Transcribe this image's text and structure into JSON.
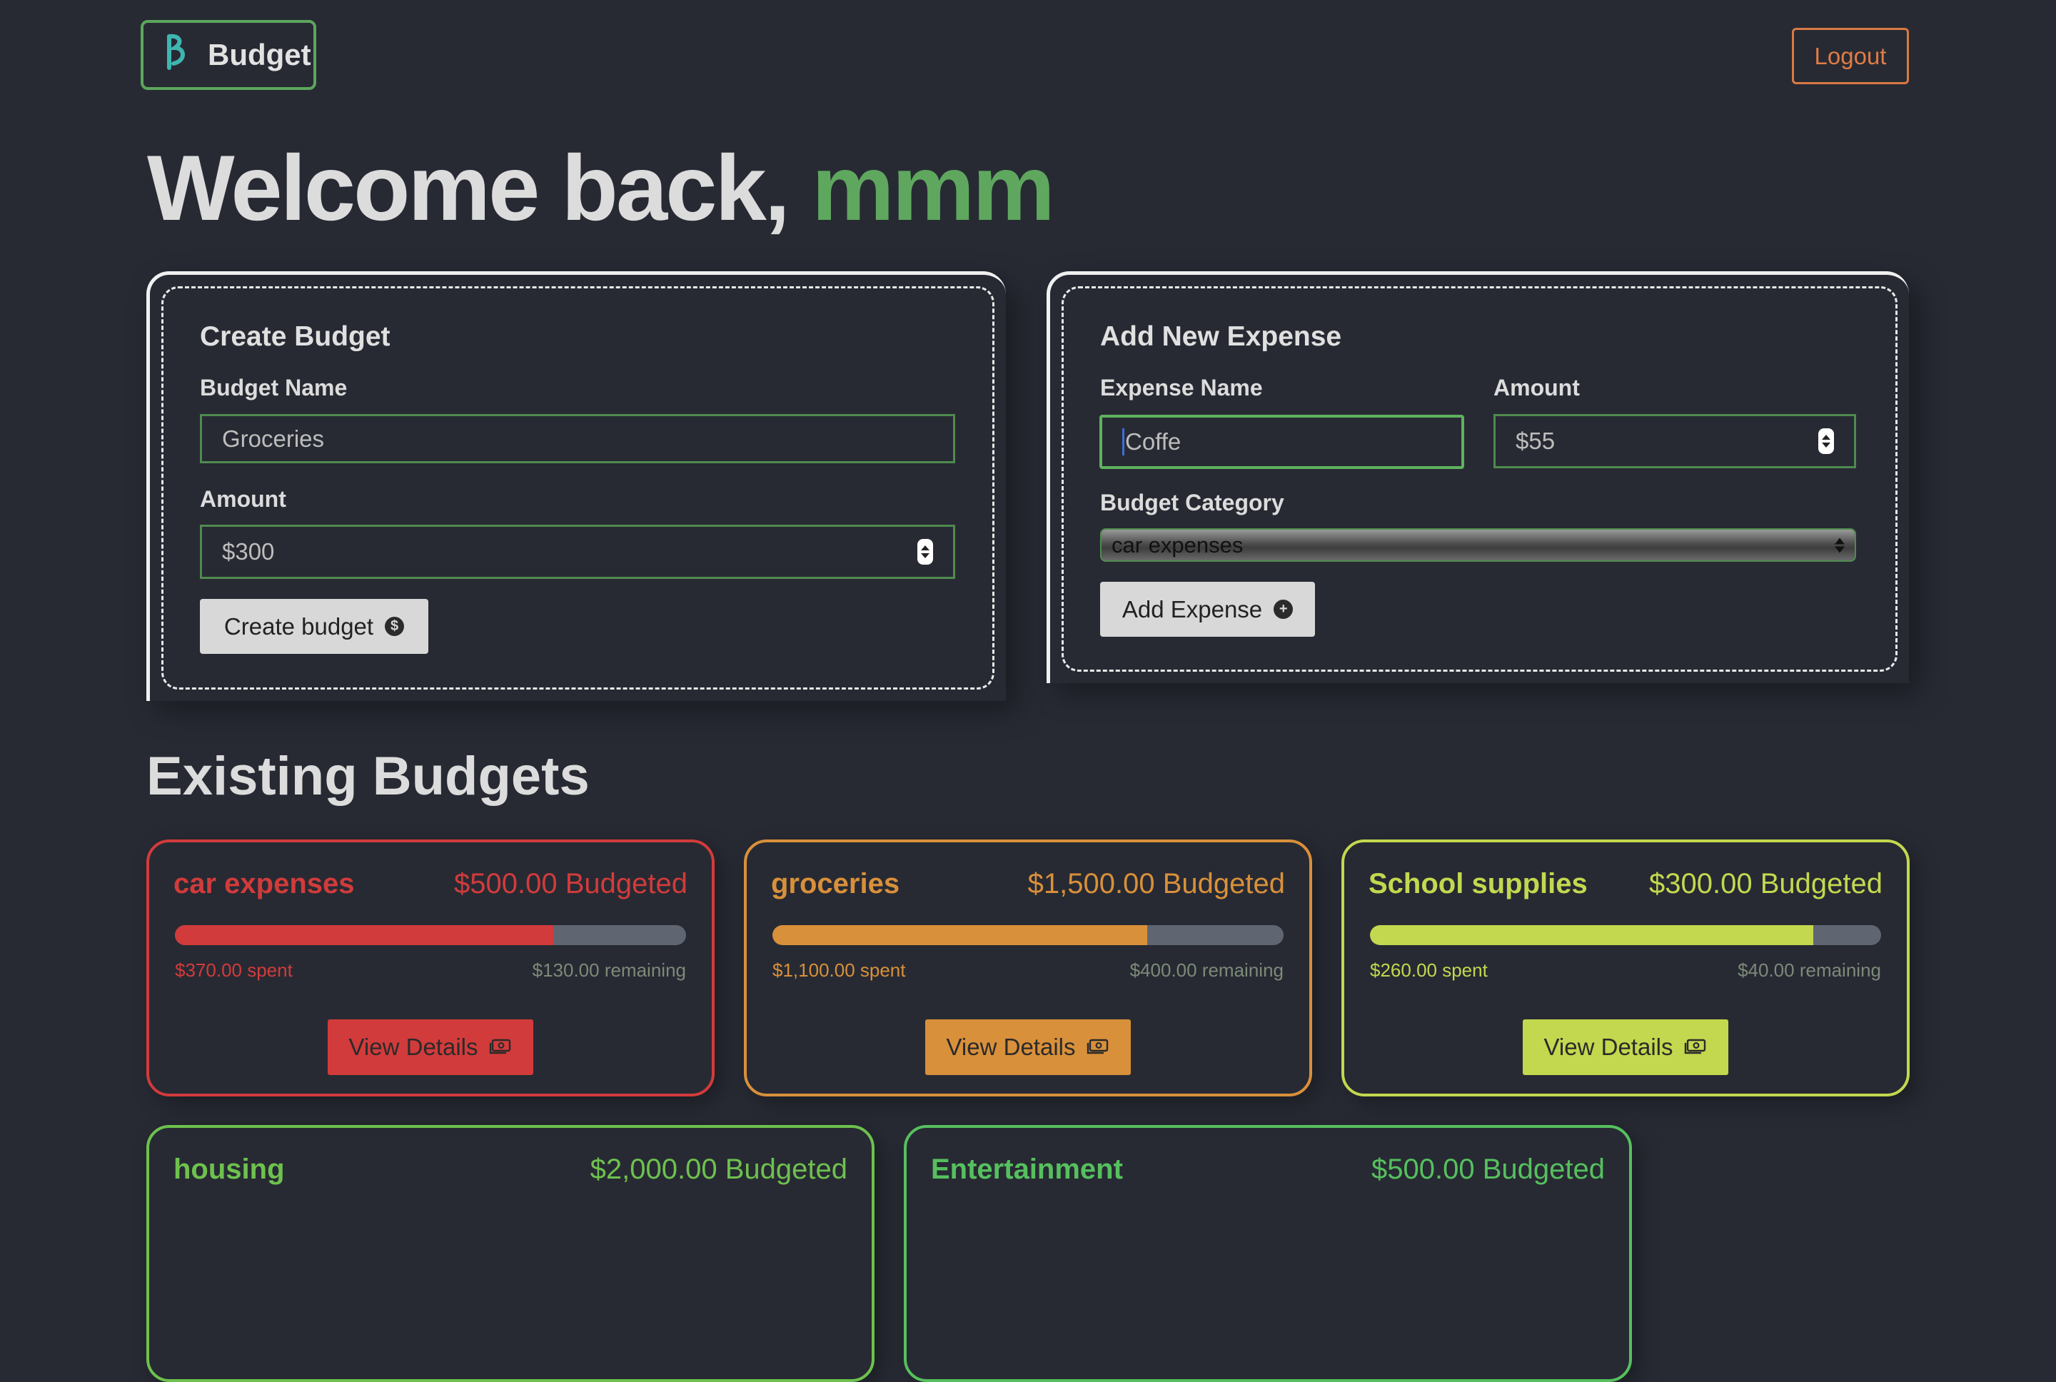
{
  "header": {
    "logo_text": "Budget",
    "logo_icon": "budget-logo-icon",
    "logout_label": "Logout"
  },
  "welcome": {
    "prefix": "Welcome back,",
    "username": "mmm"
  },
  "create_budget": {
    "title": "Create Budget",
    "name_label": "Budget Name",
    "name_placeholder": "Groceries",
    "amount_label": "Amount",
    "amount_placeholder": "$300",
    "submit_label": "Create budget",
    "submit_icon": "dollar-circle-icon"
  },
  "add_expense": {
    "title": "Add New Expense",
    "name_label": "Expense Name",
    "name_value": "Coffe",
    "amount_label": "Amount",
    "amount_placeholder": "$55",
    "category_label": "Budget Category",
    "category_selected": "car expenses",
    "submit_label": "Add Expense",
    "submit_icon": "plus-circle-icon"
  },
  "existing": {
    "title": "Existing Budgets",
    "view_label": "View Details",
    "budgets": [
      {
        "name": "car expenses",
        "budgeted": "$500.00 Budgeted",
        "spent": "$370.00 spent",
        "remaining": "$130.00 remaining",
        "progress": 0.74,
        "color": "#d23b3b"
      },
      {
        "name": "groceries",
        "budgeted": "$1,500.00 Budgeted",
        "spent": "$1,100.00 spent",
        "remaining": "$400.00 remaining",
        "progress": 0.733,
        "color": "#d9903a"
      },
      {
        "name": "School supplies",
        "budgeted": "$300.00 Budgeted",
        "spent": "$260.00 spent",
        "remaining": "$40.00 remaining",
        "progress": 0.867,
        "color": "#c3d84e"
      },
      {
        "name": "housing",
        "budgeted": "$2,000.00 Budgeted",
        "color": "#6ec14e"
      },
      {
        "name": "Entertainment",
        "budgeted": "$500.00 Budgeted",
        "color": "#56c05e"
      }
    ]
  }
}
